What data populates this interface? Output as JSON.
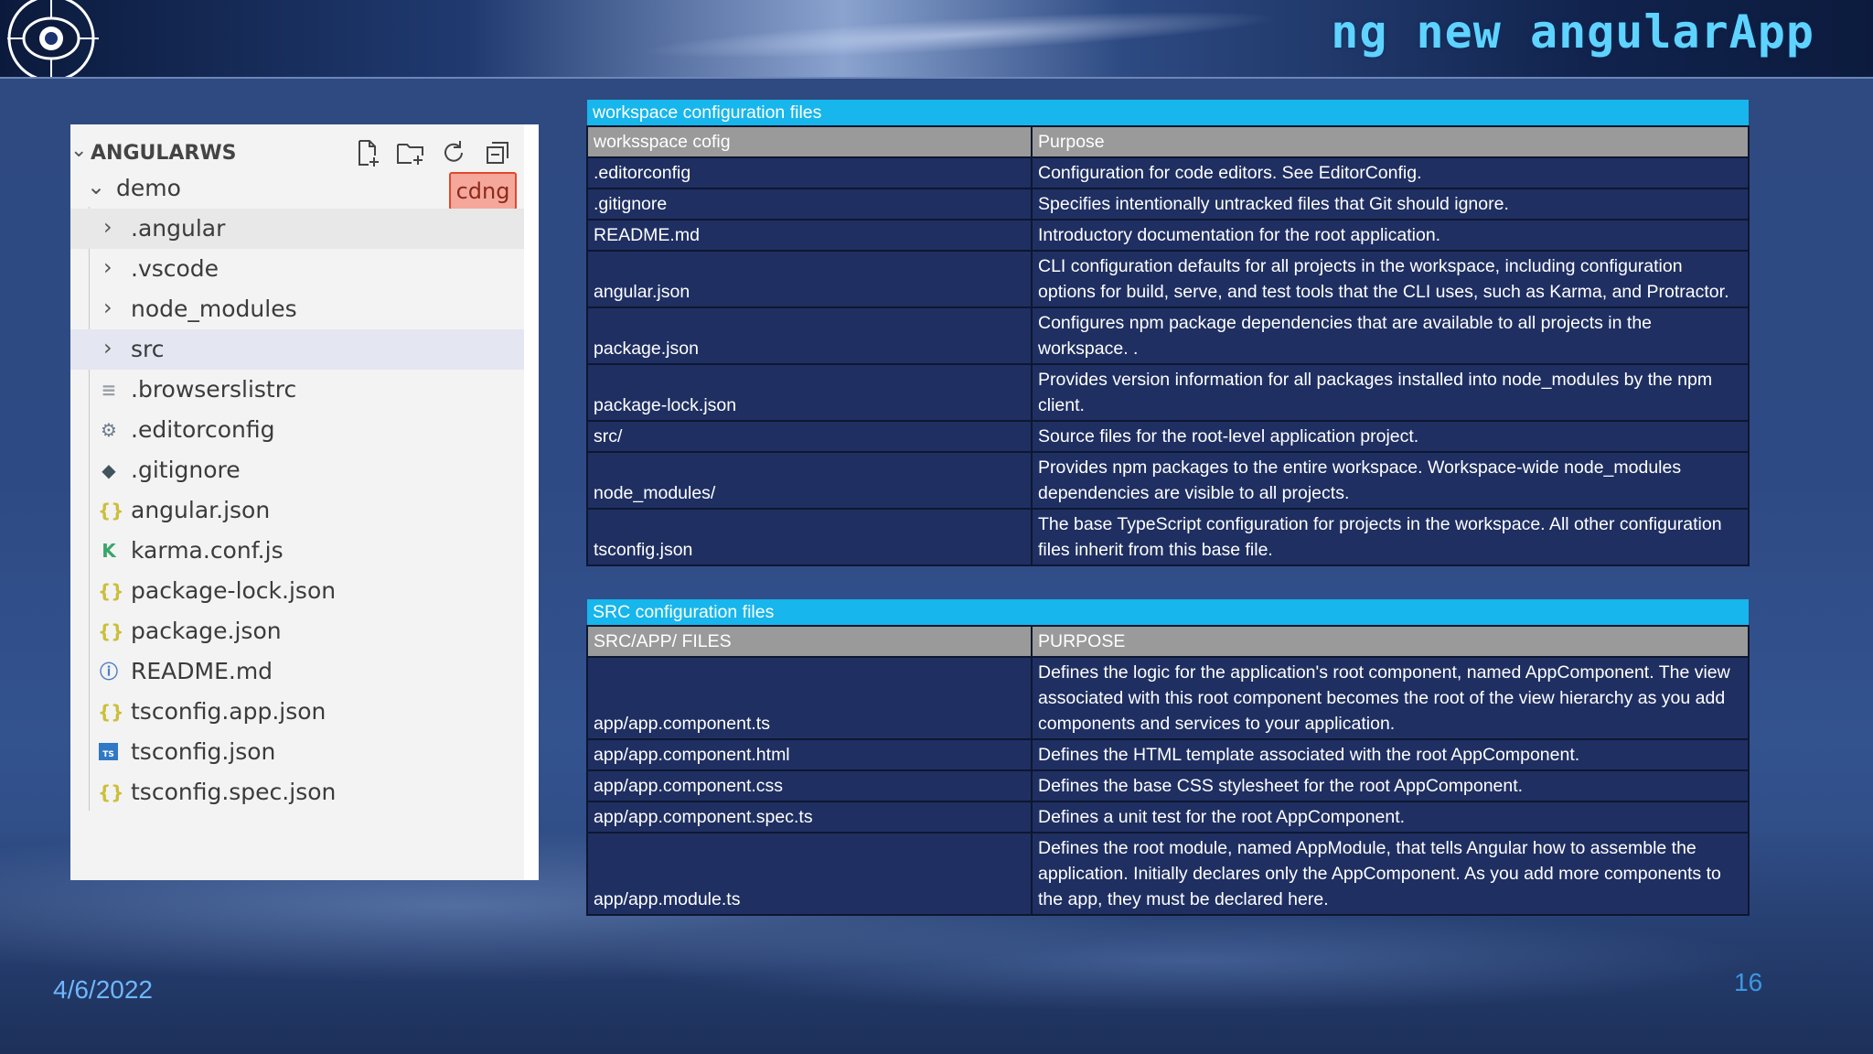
{
  "slide": {
    "title": "ng new angularApp",
    "date": "4/6/2022",
    "page_number": "16"
  },
  "explorer": {
    "root_label": "ANGULARWS",
    "toolbar_icons": [
      "new-file-icon",
      "new-folder-icon",
      "refresh-icon",
      "collapse-all-icon"
    ],
    "folder_label": "demo",
    "badge_label": "cdng",
    "items": [
      {
        "label": ".angular",
        "type": "folder",
        "icon": "chevron-right-icon"
      },
      {
        "label": ".vscode",
        "type": "folder",
        "icon": "chevron-right-icon"
      },
      {
        "label": "node_modules",
        "type": "folder",
        "icon": "chevron-right-icon"
      },
      {
        "label": "src",
        "type": "folder",
        "icon": "chevron-right-icon"
      },
      {
        "label": ".browserslistrc",
        "type": "file",
        "icon": "lines-file-icon"
      },
      {
        "label": ".editorconfig",
        "type": "file",
        "icon": "gear-icon"
      },
      {
        "label": ".gitignore",
        "type": "file",
        "icon": "git-icon"
      },
      {
        "label": "angular.json",
        "type": "file",
        "icon": "json-braces-icon"
      },
      {
        "label": "karma.conf.js",
        "type": "file",
        "icon": "karma-icon"
      },
      {
        "label": "package-lock.json",
        "type": "file",
        "icon": "json-braces-icon"
      },
      {
        "label": "package.json",
        "type": "file",
        "icon": "json-braces-icon"
      },
      {
        "label": "README.md",
        "type": "file",
        "icon": "info-icon"
      },
      {
        "label": "tsconfig.app.json",
        "type": "file",
        "icon": "json-braces-icon"
      },
      {
        "label": "tsconfig.json",
        "type": "file",
        "icon": "typescript-icon"
      },
      {
        "label": "tsconfig.spec.json",
        "type": "file",
        "icon": "json-braces-icon"
      }
    ]
  },
  "workspace_table": {
    "title": "workspace configuration files",
    "headers": [
      "worksspace cofig",
      "Purpose"
    ],
    "rows": [
      {
        "file": ".editorconfig",
        "purpose": "Configuration for code editors. See EditorConfig."
      },
      {
        "file": ".gitignore",
        "purpose": "Specifies intentionally untracked files that Git should ignore."
      },
      {
        "file": "README.md",
        "purpose": "Introductory documentation for the root application."
      },
      {
        "file": "angular.json",
        "purpose": "CLI configuration defaults for all projects in the workspace, including configuration options for build, serve, and test tools that the CLI uses, such as Karma, and Protractor."
      },
      {
        "file": "package.json",
        "purpose": "Configures npm package dependencies that are available to all projects in the workspace. ."
      },
      {
        "file": "package-lock.json",
        "purpose": "Provides version information for all packages installed into node_modules by the npm client."
      },
      {
        "file": "src/",
        "purpose": "Source files for the root-level application project."
      },
      {
        "file": "node_modules/",
        "purpose": "Provides npm packages to the entire workspace. Workspace-wide node_modules dependencies are visible to all projects."
      },
      {
        "file": "tsconfig.json",
        "purpose": "The base TypeScript configuration for projects in the workspace. All other configuration files inherit from this base file."
      }
    ]
  },
  "src_table": {
    "title": "SRC configuration files",
    "headers": [
      "SRC/APP/ FILES",
      "PURPOSE"
    ],
    "rows": [
      {
        "file": "app/app.component.ts",
        "purpose": "Defines the logic for the application's root component, named AppComponent. The view associated with this root component becomes the root of the view hierarchy as you add components and services to your application."
      },
      {
        "file": "app/app.component.html",
        "purpose": "Defines the HTML template associated with the root AppComponent."
      },
      {
        "file": "app/app.component.css",
        "purpose": "Defines the base CSS stylesheet for the root AppComponent."
      },
      {
        "file": "app/app.component.spec.ts",
        "purpose": "Defines a unit test for the root AppComponent."
      },
      {
        "file": "app/app.module.ts",
        "purpose": "Defines the root module, named AppModule, that tells Angular how to assemble the application. Initially declares only the AppComponent. As you add more components to the app, they must be declared here."
      }
    ]
  },
  "colors": {
    "title": "#5fd3ff",
    "table_title_bg": "#17b6ec",
    "table_header_bg": "#9a9a9a",
    "table_body_bg": "#1f2f62",
    "badge_bg": "#f6a79b"
  }
}
